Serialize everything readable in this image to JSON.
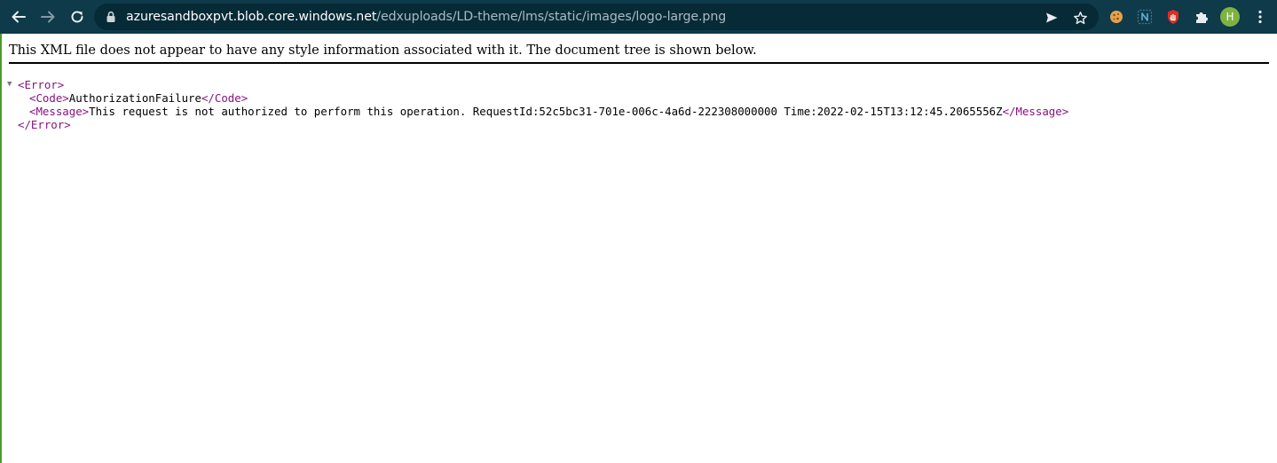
{
  "browser": {
    "url_host": "azuresandboxpvt.blob.core.windows.net",
    "url_path": "/edxuploads/LD-theme/lms/static/images/logo-large.png",
    "profile_initial": "H",
    "colors": {
      "toolbar": "#0e3a4a",
      "omnibox": "#072a37",
      "profile": "#7cb342"
    },
    "icons": [
      "back-arrow-icon",
      "forward-arrow-icon",
      "reload-icon",
      "lock-icon",
      "send-icon",
      "star-icon",
      "cookie-extension-icon",
      "n-extension-icon",
      "hand-stop-extension-icon",
      "puzzle-icon",
      "more-vertical-icon"
    ]
  },
  "page": {
    "header_text": "This XML file does not appear to have any style information associated with it. The document tree is shown below.",
    "tree": {
      "root_open": "<Error>",
      "code_open": "<Code>",
      "code_value": "AuthorizationFailure",
      "code_close": "</Code>",
      "message_open": "<Message>",
      "message_value": "This request is not authorized to perform this operation. RequestId:52c5bc31-701e-006c-4a6d-222308000000 Time:2022-02-15T13:12:45.2065556Z",
      "message_close": "</Message>",
      "root_close": "</Error>"
    }
  }
}
